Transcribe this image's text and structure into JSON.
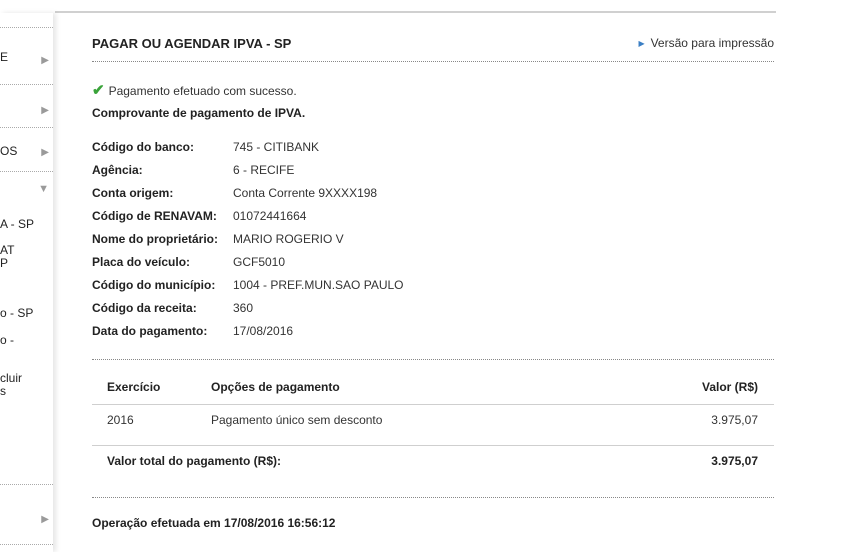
{
  "sidebar": {
    "items": [
      {
        "label": "E"
      },
      {
        "label": ""
      },
      {
        "label": "OS"
      },
      {
        "label": ""
      },
      {
        "label": "A - SP"
      },
      {
        "label": "AT\nP"
      },
      {
        "label": "o - SP"
      },
      {
        "label": "o -"
      },
      {
        "label": "cluir\ns"
      },
      {
        "label": ""
      }
    ]
  },
  "page": {
    "title": "PAGAR OU AGENDAR IPVA - SP",
    "print_label": "Versão para impressão",
    "success_message": "Pagamento efetuado com sucesso.",
    "receipt_title": "Comprovante de pagamento de IPVA."
  },
  "details": [
    {
      "label": "Código do banco:",
      "value": "745 - CITIBANK"
    },
    {
      "label": "Agência:",
      "value": "6 - RECIFE"
    },
    {
      "label": "Conta origem:",
      "value": "Conta Corrente 9XXXX198"
    },
    {
      "label": "Código de RENAVAM:",
      "value": "01072441664"
    },
    {
      "label": "Nome do proprietário:",
      "value": "MARIO ROGERIO V"
    },
    {
      "label": "Placa do veículo:",
      "value": "GCF5010"
    },
    {
      "label": "Código do município:",
      "value": "1004 - PREF.MUN.SAO PAULO"
    },
    {
      "label": "Código da receita:",
      "value": "360"
    },
    {
      "label": "Data do pagamento:",
      "value": "17/08/2016"
    }
  ],
  "table": {
    "headers": {
      "year": "Exercício",
      "option": "Opções de pagamento",
      "value": "Valor (R$)"
    },
    "rows": [
      {
        "year": "2016",
        "option": "Pagamento único sem desconto",
        "value": "3.975,07"
      }
    ],
    "total_label": "Valor total do pagamento (R$):",
    "total_value": "3.975,07"
  },
  "footer": {
    "operation": "Operação efetuada em 17/08/2016 16:56:12"
  },
  "icons": {
    "success": "check-icon",
    "print": "triangle-right-icon",
    "sidebar_collapsed": "chevron-right-icon",
    "sidebar_expanded": "chevron-down-icon"
  },
  "colors": {
    "success": "#3aa33a",
    "link_marker": "#3b7fc4"
  }
}
